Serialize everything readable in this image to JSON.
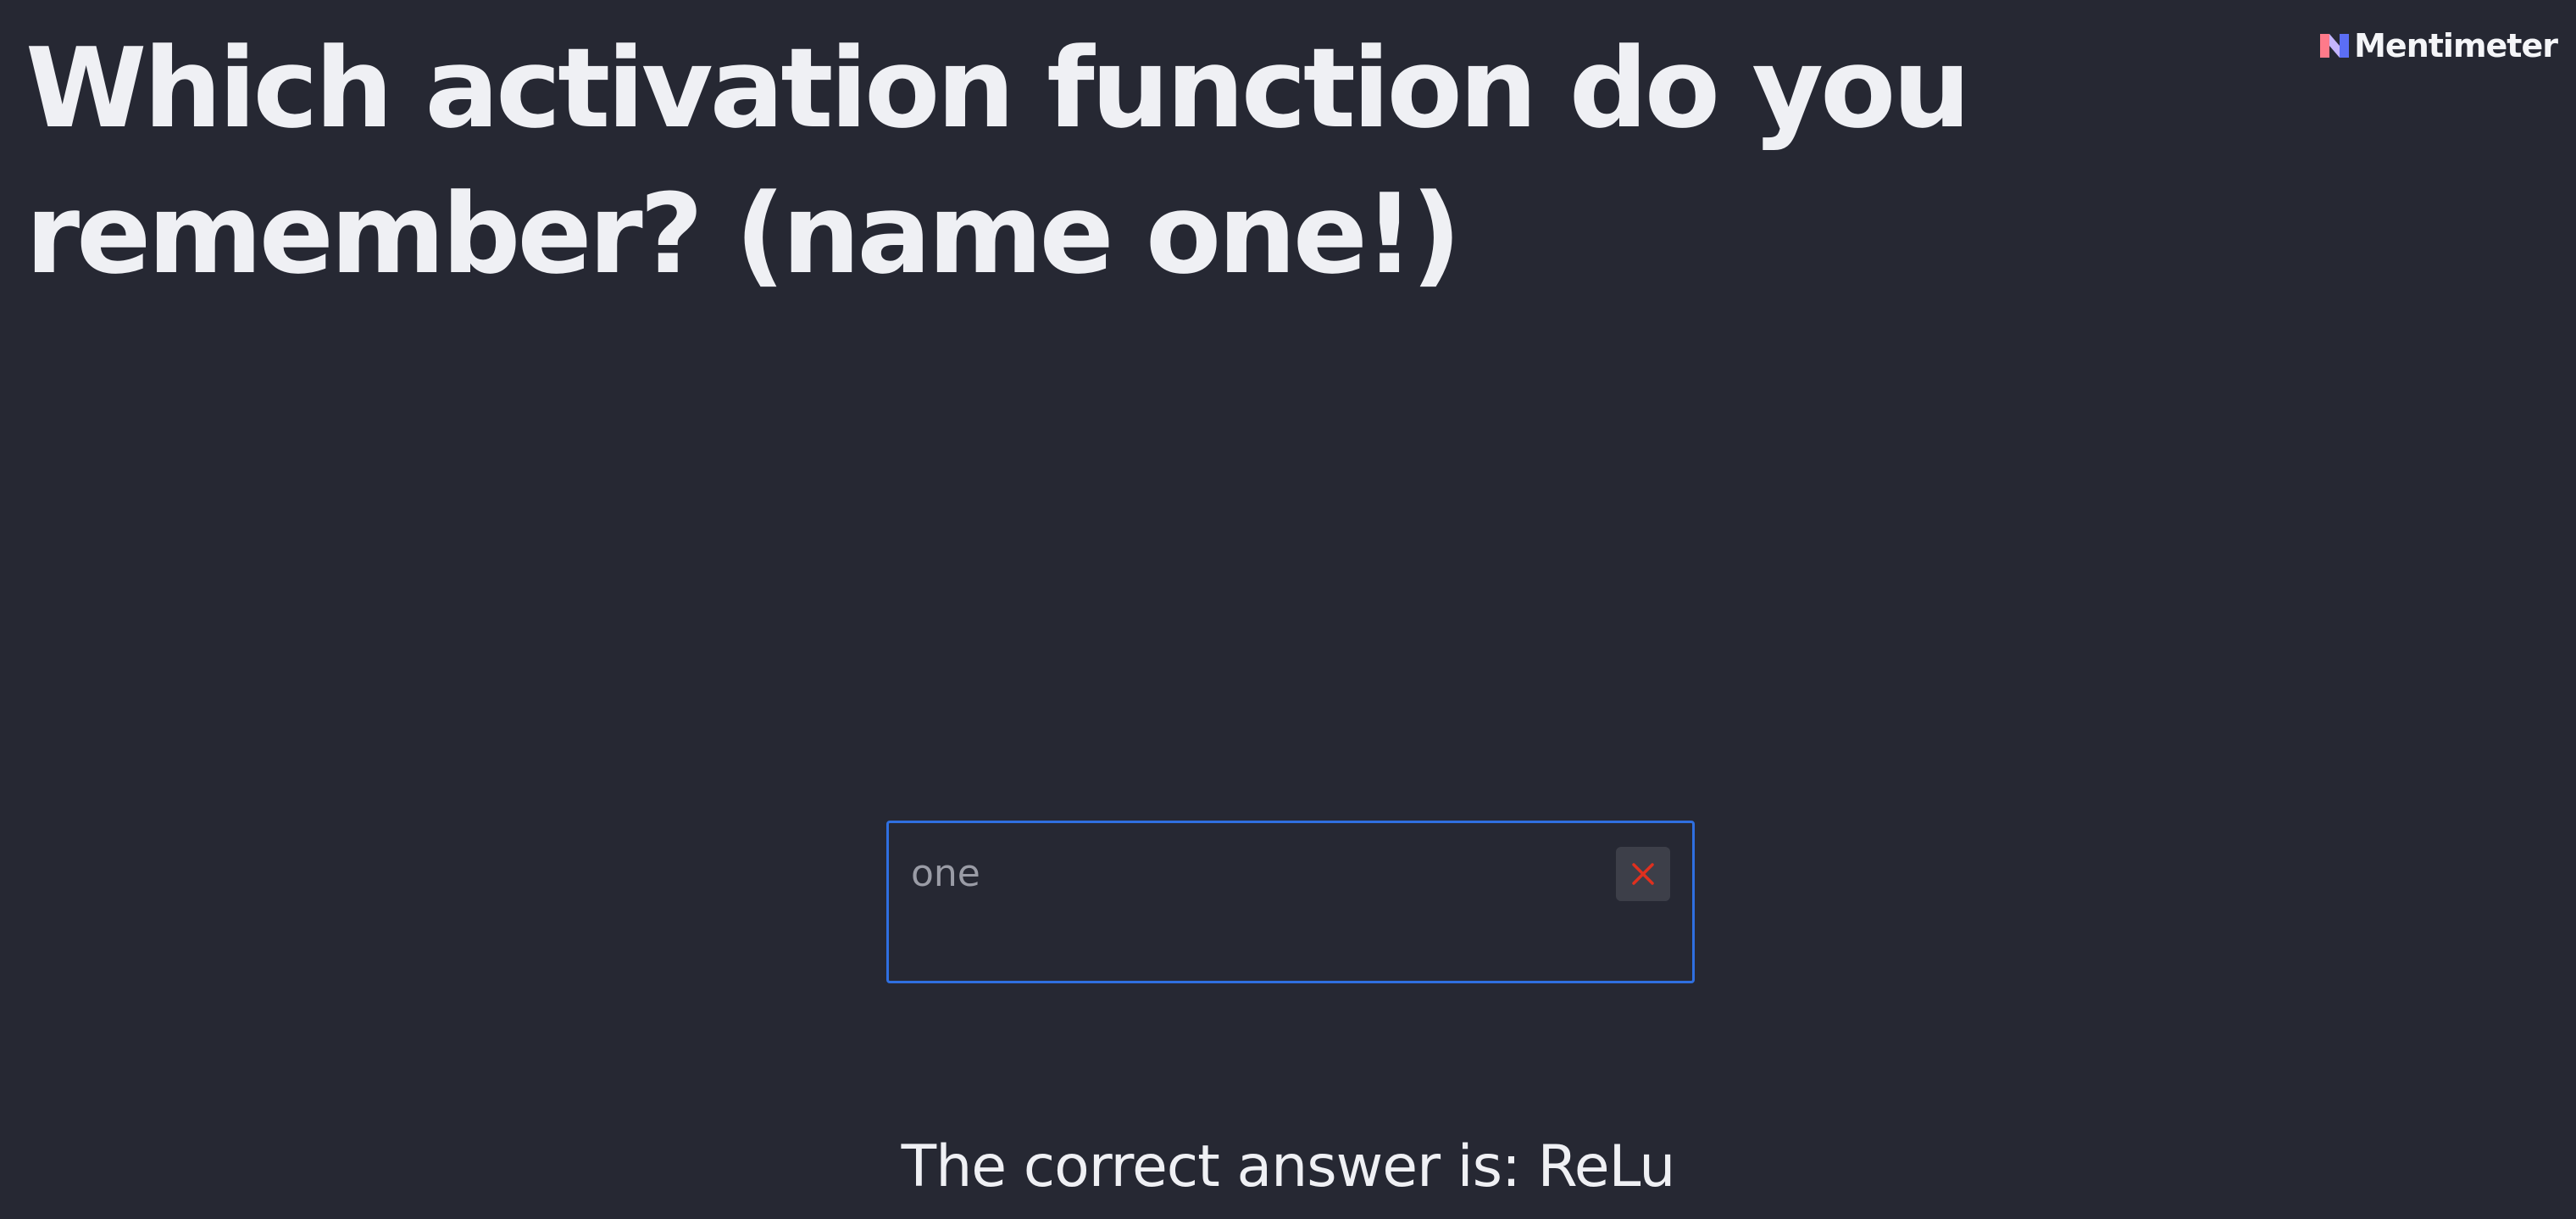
{
  "question": {
    "line1": "Which activation function do you",
    "line2": "remember? (name one!)"
  },
  "brand": {
    "name": "Mentimeter",
    "icon": "mentimeter-logo-icon"
  },
  "answer": {
    "value": "one",
    "status_icon": "close-icon",
    "status_color": "#e0301e",
    "border_color": "#2f6fe0"
  },
  "result": {
    "text": "The correct answer is: ReLu"
  },
  "colors": {
    "background": "#262833",
    "text": "#eff0f4"
  }
}
